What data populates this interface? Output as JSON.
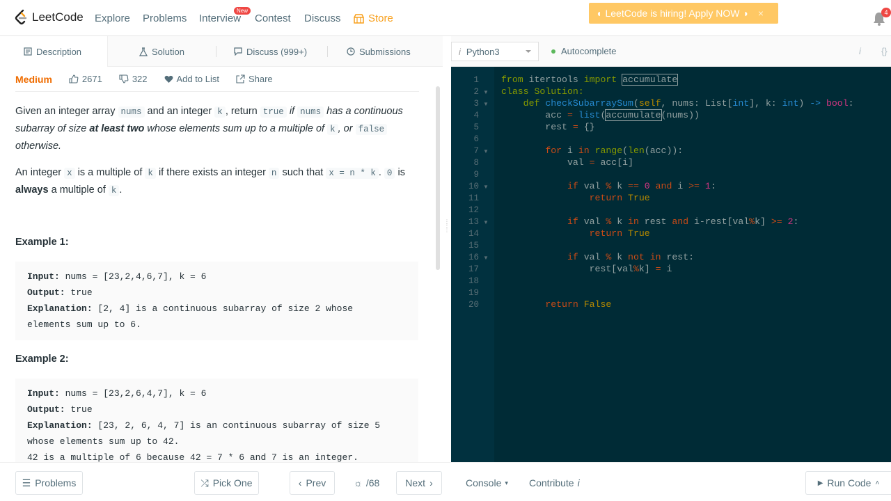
{
  "nav": {
    "logo_text": "LeetCode",
    "items": [
      "Explore",
      "Problems",
      "Interview",
      "Contest",
      "Discuss"
    ],
    "new_badge": "New",
    "store": "Store",
    "hiring": "LeetCode is hiring! Apply NOW",
    "hiring_close": "×",
    "notification_count": "4"
  },
  "tabs": {
    "description": "Description",
    "solution": "Solution",
    "discuss": "Discuss (999+)",
    "submissions": "Submissions"
  },
  "meta": {
    "difficulty": "Medium",
    "likes": "2671",
    "dislikes": "322",
    "add_to_list": "Add to List",
    "share": "Share"
  },
  "description": {
    "p1": {
      "t1": "Given an integer array ",
      "c1": "nums",
      "t2": " and an integer ",
      "c2": "k",
      "t3": ", return ",
      "c3": "true",
      "t4": " if ",
      "c4": "nums",
      "t5": " has a continuous subarray of size ",
      "b1": "at least two",
      "t6": " whose elements sum up to a multiple of ",
      "c5": "k",
      "t7": ", or ",
      "c6": "false",
      "t8": " otherwise."
    },
    "p2": {
      "t1": "An integer ",
      "c1": "x",
      "t2": " is a multiple of ",
      "c2": "k",
      "t3": " if there exists an integer ",
      "c3": "n",
      "t4": " such that ",
      "c4": "x = n * k",
      "t5": ". ",
      "c5": "0",
      "t6": " is ",
      "b1": "always",
      "t7": " a multiple of ",
      "c6": "k",
      "t8": "."
    }
  },
  "examples": [
    {
      "title": "Example 1:",
      "input_label": "Input:",
      "input": " nums = [23,2,4,6,7], k = 6",
      "output_label": "Output:",
      "output": " true",
      "explanation_label": "Explanation:",
      "explanation_1": " [2, 4] is a continuous subarray of size 2 whose",
      "explanation_2": "elements sum up to 6."
    },
    {
      "title": "Example 2:",
      "input_label": "Input:",
      "input": " nums = [23,2,6,4,7], k = 6",
      "output_label": "Output:",
      "output": " true",
      "explanation_label": "Explanation:",
      "explanation_1": " [23, 2, 6, 4, 7] is an continuous subarray of size 5",
      "explanation_2": "whose elements sum up to 42.",
      "explanation_3": "42 is a multiple of 6 because 42 = 7 * 6 and 7 is an integer."
    }
  ],
  "editor": {
    "language": "Python3",
    "autocomplete": "Autocomplete",
    "info_icon": "i",
    "braces_icon": "{}",
    "line_numbers": [
      "1",
      "2",
      "3",
      "4",
      "5",
      "6",
      "7",
      "8",
      "9",
      "10",
      "11",
      "12",
      "13",
      "14",
      "15",
      "16",
      "17",
      "18",
      "19",
      "20"
    ],
    "code": {
      "l1a": "from",
      "l1b": " itertools ",
      "l1c": "import",
      "l1d": " ",
      "l1e": "accumulate",
      "l2a": "class",
      "l2b": " Solution:",
      "l3a": "    def ",
      "l3b": "checkSubarraySum",
      "l3c": "(",
      "l3d": "self",
      "l3e": ", nums: List[",
      "l3f": "int",
      "l3g": "], k: ",
      "l3h": "int",
      "l3i": ") ",
      "l3j": "->",
      "l3k": " ",
      "l3l": "bool",
      "l3m": ":",
      "l4a": "        acc ",
      "l4b": "=",
      "l4c": " ",
      "l4d": "list",
      "l4e": "(",
      "l4f": "accumulate",
      "l4g": "(nums))",
      "l5a": "        rest ",
      "l5b": "=",
      "l5c": " {}",
      "l7a": "        ",
      "l7b": "for",
      "l7c": " i ",
      "l7d": "in",
      "l7e": " ",
      "l7f": "range",
      "l7g": "(",
      "l7h": "len",
      "l7i": "(acc)):",
      "l8a": "            val ",
      "l8b": "=",
      "l8c": " acc[i]",
      "l10a": "            ",
      "l10b": "if",
      "l10c": " val ",
      "l10d": "%",
      "l10e": " k ",
      "l10f": "==",
      "l10g": " ",
      "l10h": "0",
      "l10i": " ",
      "l10j": "and",
      "l10k": " i ",
      "l10l": ">=",
      "l10m": " ",
      "l10n": "1",
      "l10o": ":",
      "l11a": "                ",
      "l11b": "return",
      "l11c": " ",
      "l11d": "True",
      "l13a": "            ",
      "l13b": "if",
      "l13c": " val ",
      "l13d": "%",
      "l13e": " k ",
      "l13f": "in",
      "l13g": " rest ",
      "l13h": "and",
      "l13i": " i-rest[val",
      "l13j": "%",
      "l13k": "k] ",
      "l13l": ">=",
      "l13m": " ",
      "l13n": "2",
      "l13o": ":",
      "l14a": "                ",
      "l14b": "return",
      "l14c": " ",
      "l14d": "True",
      "l16a": "            ",
      "l16b": "if",
      "l16c": " val ",
      "l16d": "%",
      "l16e": " k ",
      "l16f": "not",
      "l16g": " ",
      "l16h": "in",
      "l16i": " rest:",
      "l17a": "                rest[val",
      "l17b": "%",
      "l17c": "k] ",
      "l17d": "=",
      "l17e": " i",
      "l20a": "        ",
      "l20b": "return",
      "l20c": " ",
      "l20d": "False"
    }
  },
  "bottom": {
    "problems": "Problems",
    "pick_one": "Pick One",
    "prev": "Prev",
    "page": "/68",
    "next": "Next",
    "console": "Console",
    "contribute": "Contribute",
    "contribute_icon": "i",
    "run_code": "Run Code"
  },
  "colors": {
    "accent_orange": "#f89f1b",
    "difficulty_medium": "#ef6c00",
    "editor_bg": "#002b36",
    "hiring_bg": "#ffc864",
    "badge_red": "#ef4743"
  }
}
